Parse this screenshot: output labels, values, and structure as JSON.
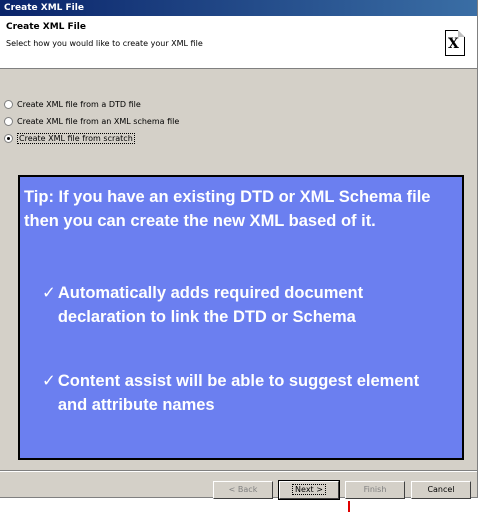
{
  "window": {
    "title": "Create XML File"
  },
  "header": {
    "title": "Create XML File",
    "description": "Select how you would like to create your XML file",
    "icon": "xml-file-icon"
  },
  "options": [
    {
      "label": "Create XML file from a DTD file",
      "checked": false
    },
    {
      "label": "Create XML file from an XML schema file",
      "checked": false
    },
    {
      "label": "Create XML file from scratch",
      "checked": true
    }
  ],
  "tip": {
    "text": "Tip:  If you have an existing DTD or XML Schema file then you can create the new XML based of it.",
    "bullets": [
      "Automatically adds required document declaration to link the DTD or Schema",
      "Content assist will be able to suggest element and attribute names"
    ],
    "check_glyph": "✓",
    "background": "#6b7ff0"
  },
  "buttons": {
    "back": "< Back",
    "next": "Next >",
    "finish": "Finish",
    "cancel": "Cancel"
  }
}
